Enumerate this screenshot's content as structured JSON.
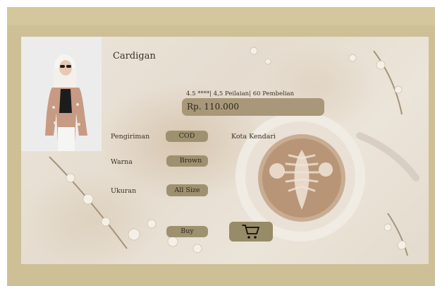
{
  "product": {
    "title": "Cardigan",
    "stats": "4.5 ****| 4,5 Peilaian| 60 Pembelian",
    "price": "Rp. 110.000",
    "image_alt": "model-wearing-cardigan"
  },
  "details": {
    "shipping_label": "Pengiriman",
    "shipping_value": "COD",
    "shipping_city": "Kota Kendari",
    "color_label": "Warna",
    "color_value": "Brown",
    "size_label": "Ukuran",
    "size_value": "All Size"
  },
  "actions": {
    "buy_label": "Buy",
    "cart_icon": "shopping-cart-icon"
  },
  "colors": {
    "frame": "#cdc096",
    "button": "#9e9170",
    "price_box": "#a89879",
    "text": "#3a3024"
  }
}
